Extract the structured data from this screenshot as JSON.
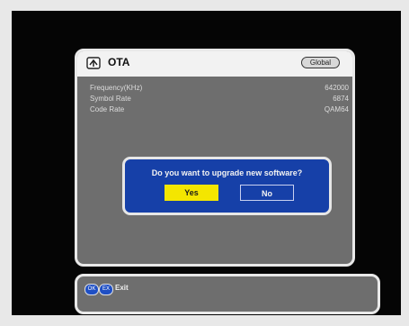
{
  "ota": {
    "title": "OTA",
    "badge": "Global",
    "rows": [
      {
        "label": "Frequency(KHz)",
        "value": "642000"
      },
      {
        "label": "Symbol Rate",
        "value": "6874"
      },
      {
        "label": "Code Rate",
        "value": "QAM64"
      }
    ]
  },
  "dialog": {
    "message": "Do you want to upgrade new software?",
    "yes_label": "Yes",
    "no_label": "No"
  },
  "help": {
    "key1": "OK",
    "key2": "EX",
    "text": "Exit"
  },
  "colors": {
    "panel": "#6e6e6e",
    "dialog": "#1640a8",
    "highlight": "#f4e600"
  },
  "icons": {
    "ota": "ota-icon"
  }
}
